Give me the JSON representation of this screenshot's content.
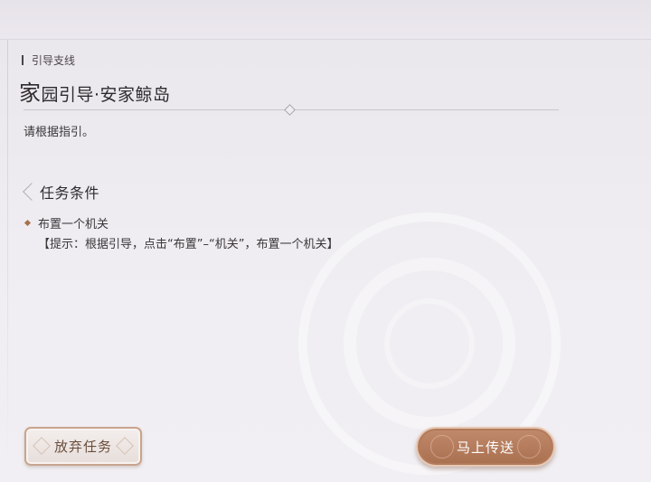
{
  "header": {
    "category": "引导支线",
    "title_first_char": "家",
    "title_rest": "园引导·安家鲸岛"
  },
  "description": "请根据指引。",
  "conditions": {
    "title": "任务条件",
    "items": [
      {
        "label": "布置一个机关",
        "hint": "【提示：根据引导，点击“布置”–“机关”，布置一个机关】"
      }
    ]
  },
  "buttons": {
    "abandon": "放弃任务",
    "teleport": "马上传送"
  },
  "colors": {
    "accent": "#a9704f",
    "bullet": "#a5704a"
  }
}
